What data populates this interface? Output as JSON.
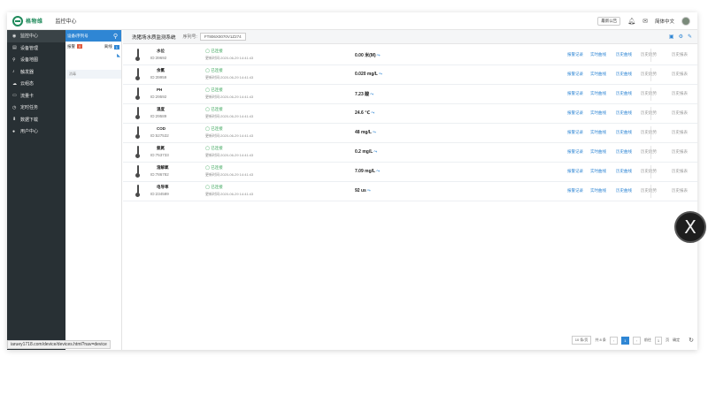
{
  "topbar": {
    "logo_text": "格物维",
    "app_title": "监控中心",
    "badge": "最新公告",
    "lang": "简体中文"
  },
  "nav": {
    "items": [
      {
        "label": "监控中心",
        "icon": "monitor-icon"
      },
      {
        "label": "设备管理",
        "icon": "device-icon"
      },
      {
        "label": "设备地图",
        "icon": "map-pin-icon"
      },
      {
        "label": "触发器",
        "icon": "bell-icon"
      },
      {
        "label": "云组态",
        "icon": "cloud-icon"
      },
      {
        "label": "流量卡",
        "icon": "sim-card-icon"
      },
      {
        "label": "定时任务",
        "icon": "clock-icon"
      },
      {
        "label": "数据下载",
        "icon": "download-icon"
      },
      {
        "label": "用户中心",
        "icon": "user-icon"
      }
    ]
  },
  "device_panel": {
    "search_placeholder": "设备/序列号",
    "tab_alarm": "报警",
    "alarm_count": "0",
    "tab_offline": "离线",
    "offline_count": "1",
    "rows": [
      "",
      "消毒"
    ]
  },
  "main": {
    "device_name": "洗猪场水质监测系统",
    "serial_label": "序列号:",
    "serial": "FT806X0070V1Z274"
  },
  "sensors": [
    {
      "name": "水位",
      "id": "ID:39692",
      "status": "已连接",
      "updated": "更新时间:2020-06-29 14:41:43",
      "value": "0.00 米(M)",
      "links": [
        "报警记录",
        "实时曲线",
        "历史曲线",
        "历史趋势",
        "历史报表"
      ]
    },
    {
      "name": "余氯",
      "id": "ID:39959",
      "status": "已连接",
      "updated": "更新时间:2020-06-29 14:41:43",
      "value": "0.020 mg/L",
      "links": [
        "报警记录",
        "实时曲线",
        "历史曲线",
        "历史趋势",
        "历史报表"
      ]
    },
    {
      "name": "PH",
      "id": "ID:29592",
      "status": "已连接",
      "updated": "更新时间:2020-06-29 14:41:43",
      "value": "7.23 酸",
      "links": [
        "报警记录",
        "实时曲线",
        "历史曲线",
        "历史趋势",
        "历史报表"
      ]
    },
    {
      "name": "温度",
      "id": "ID:29589",
      "status": "已连接",
      "updated": "更新时间:2020-06-29 14:41:43",
      "value": "24.6 ℃",
      "links": [
        "报警记录",
        "实时曲线",
        "历史曲线",
        "历史趋势",
        "历史报表"
      ]
    },
    {
      "name": "COD",
      "id": "ID:527532",
      "status": "已连接",
      "updated": "更新时间:2020-06-29 14:41:43",
      "value": "48 mg/L",
      "links": [
        "报警记录",
        "实时曲线",
        "历史曲线",
        "历史趋势",
        "历史报表"
      ]
    },
    {
      "name": "氨氮",
      "id": "ID:753733",
      "status": "已连接",
      "updated": "更新时间:2020-06-29 14:41:43",
      "value": "0.2 mg/L",
      "links": [
        "报警记录",
        "实时曲线",
        "历史曲线",
        "历史趋势",
        "历史报表"
      ]
    },
    {
      "name": "溶解氧",
      "id": "ID:786782",
      "status": "已连接",
      "updated": "更新时间:2020-06-29 14:41:43",
      "value": "7.09 mg/L",
      "links": [
        "报警记录",
        "实时曲线",
        "历史曲线",
        "历史趋势",
        "历史报表"
      ]
    },
    {
      "name": "电导率",
      "id": "ID:234589",
      "status": "已连接",
      "updated": "更新时间:2020-06-29 14:41:43",
      "value": "92 us",
      "links": [
        "报警记录",
        "实时曲线",
        "历史曲线",
        "历史趋势",
        "历史报表"
      ]
    }
  ],
  "pager": {
    "page_size": "10 条/页",
    "total": "共 8 条",
    "current": "1",
    "goto_label": "前往",
    "goto_value": "1",
    "page_unit": "页",
    "confirm": "确定"
  },
  "statusbar": "iaruey1718.com/device/devices.html?nav=device",
  "float_close": "X"
}
